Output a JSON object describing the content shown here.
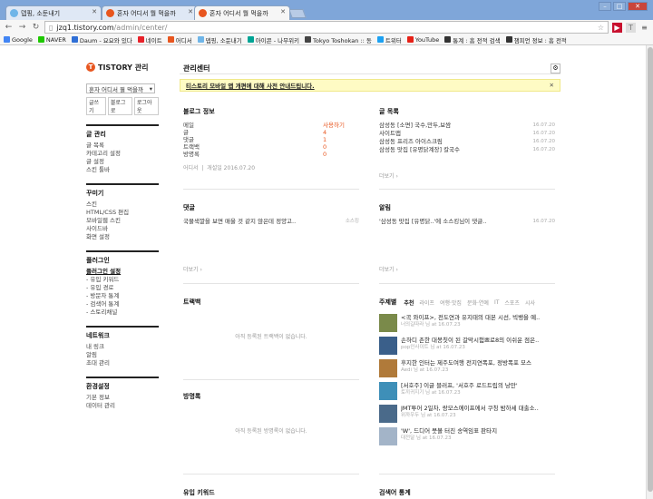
{
  "browser": {
    "tabs": [
      {
        "label": "뎁핑, 소둔내기",
        "icon": "#6fb5e8"
      },
      {
        "label": "혼자 어디서 뭘 먹을까",
        "icon": "#e8561f"
      },
      {
        "label": "혼자 어디서 뭘 먹을까",
        "icon": "#e8561f"
      }
    ],
    "url_host": "jzq1.tistory.com",
    "url_path": "/admin/center/",
    "bookmarks": [
      {
        "label": "Google",
        "color": "#4285f4"
      },
      {
        "label": "NAVER",
        "color": "#1ec800"
      },
      {
        "label": "Daum - 요요와 있다",
        "color": "#2f6fd6"
      },
      {
        "label": "네이트",
        "color": "#e8222a"
      },
      {
        "label": "어디서",
        "color": "#e8561f"
      },
      {
        "label": "뎁핑, 소둔내기",
        "color": "#6fb5e8"
      },
      {
        "label": "아이콘 - 나무위키",
        "color": "#00a495"
      },
      {
        "label": "Tokyo Toshokan :: 동",
        "color": "#444"
      },
      {
        "label": "트위터",
        "color": "#1da1f2"
      },
      {
        "label": "YouTube",
        "color": "#e62117"
      },
      {
        "label": "통계 : 흠 전적 검색",
        "color": "#333"
      },
      {
        "label": "챔피언 정보 : 흠 전적",
        "color": "#333"
      }
    ]
  },
  "sidebar": {
    "logo": "TISTORY 관리",
    "blog_name": "혼자 어디서 뭘 먹을까",
    "links": [
      "글쓰기",
      "블로그로",
      "로그아웃"
    ],
    "groups": [
      {
        "title": "글 관리",
        "items": [
          "글 목록",
          "카테고리 설정",
          "글 설정",
          "스킨 툴바"
        ]
      },
      {
        "title": "꾸미기",
        "items": [
          "스킨",
          "HTML/CSS 편집",
          "모바일웹 스킨",
          "사이드바",
          "화면 설정"
        ]
      },
      {
        "title": "플러그인",
        "items": [
          "플러그인 설정",
          "- 유입 키워드",
          "- 유입 경로",
          "- 방문자 통계",
          "- 검색어 통계",
          "- 스토리채널"
        ]
      },
      {
        "title": "네트워크",
        "items": [
          "내 링크",
          "알림",
          "초대 관리"
        ]
      },
      {
        "title": "환경설정",
        "items": [
          "기본 정보",
          "데이터 관리"
        ]
      }
    ]
  },
  "main": {
    "title": "관리센터",
    "notice": "티스토리 모바일 앱 개편에 대해 사전 안내드립니다.",
    "blog_info": {
      "title": "블로그 정보",
      "rows": [
        {
          "k": "메일",
          "v": "사용하기"
        },
        {
          "k": "글",
          "v": "4"
        },
        {
          "k": "댓글",
          "v": "1"
        },
        {
          "k": "트랙백",
          "v": "0"
        },
        {
          "k": "방명록",
          "v": "0"
        }
      ],
      "meta1": "어디서",
      "meta2": "개설일 2016.07.20"
    },
    "post_list": {
      "title": "글 목록",
      "items": [
        {
          "t": "삼성동 [소면] 국수,만두,보쌈",
          "d": "16.07.20"
        },
        {
          "t": "사이트맵",
          "d": "16.07.20"
        },
        {
          "t": "삼성동 프리즈 아이스크림",
          "d": "16.07.20"
        },
        {
          "t": "삼성동 맛집 [유명닭계장] 칼국수",
          "d": "16.07.20"
        }
      ],
      "more": "더보기 ›"
    },
    "comments": {
      "title": "댓글",
      "item": "국물색깔을 보면 매울 것 같지 않은데 정양고..",
      "author": "소스킹",
      "more": "더보기 ›"
    },
    "alerts": {
      "title": "알림",
      "item": "'삼성동 맛집 [유명닭..'에 소스킹님이 댓글..",
      "date": "16.07.20",
      "more": "더보기 ›"
    },
    "trackback": {
      "title": "트랙백",
      "empty": "아직 등록된 트랙백이 없습니다."
    },
    "guestbook": {
      "title": "방명록",
      "empty": "아직 등록된 방명록이 없습니다."
    },
    "topics": {
      "title": "주제별",
      "tabs": [
        "추천",
        "라이프",
        "여행·맛집",
        "문화·연예",
        "IT",
        "스포츠",
        "시사"
      ],
      "items": [
        {
          "title": "<곡 와이프>, 전도연과 유지태의 대본 시선, 빅뱅을 예..",
          "by": "너의길따라 님 at 16.07.23",
          "color": "#7a8a4a"
        },
        {
          "title": "손하디 촌한 대봉칫이 된 갈막시험쁘로8의 이쉬운 점은..",
          "by": "pop인사이트 님 at 16.07.23",
          "color": "#3a5f8a"
        },
        {
          "title": "후지한 인터는 제주도여행 전지연폭포, 정방폭포 모스",
          "by": "Aedi 님 at 16.07.23",
          "color": "#b07a3a"
        },
        {
          "title": "[서호주] 이글 블러프, '서호주 로드트립의 낭만'",
          "by": "토끼귀지기 님 at 16.07.23",
          "color": "#3e8fb8"
        },
        {
          "title": "JMT투어 2일차, 랑모스에이프에서 쿠칭 밤하세 대출소..",
          "by": "위까우두 님 at 16.07.23",
          "color": "#4a6a8a"
        },
        {
          "title": "'W', 드디어 뭇볼 터진 송역임표 판타지",
          "by": "대전달 님 at 16.07.23",
          "color": "#a3b4c8"
        }
      ]
    },
    "keywords": {
      "title": "유입 키워드"
    },
    "search_stats": {
      "title": "검색어 통계"
    }
  }
}
